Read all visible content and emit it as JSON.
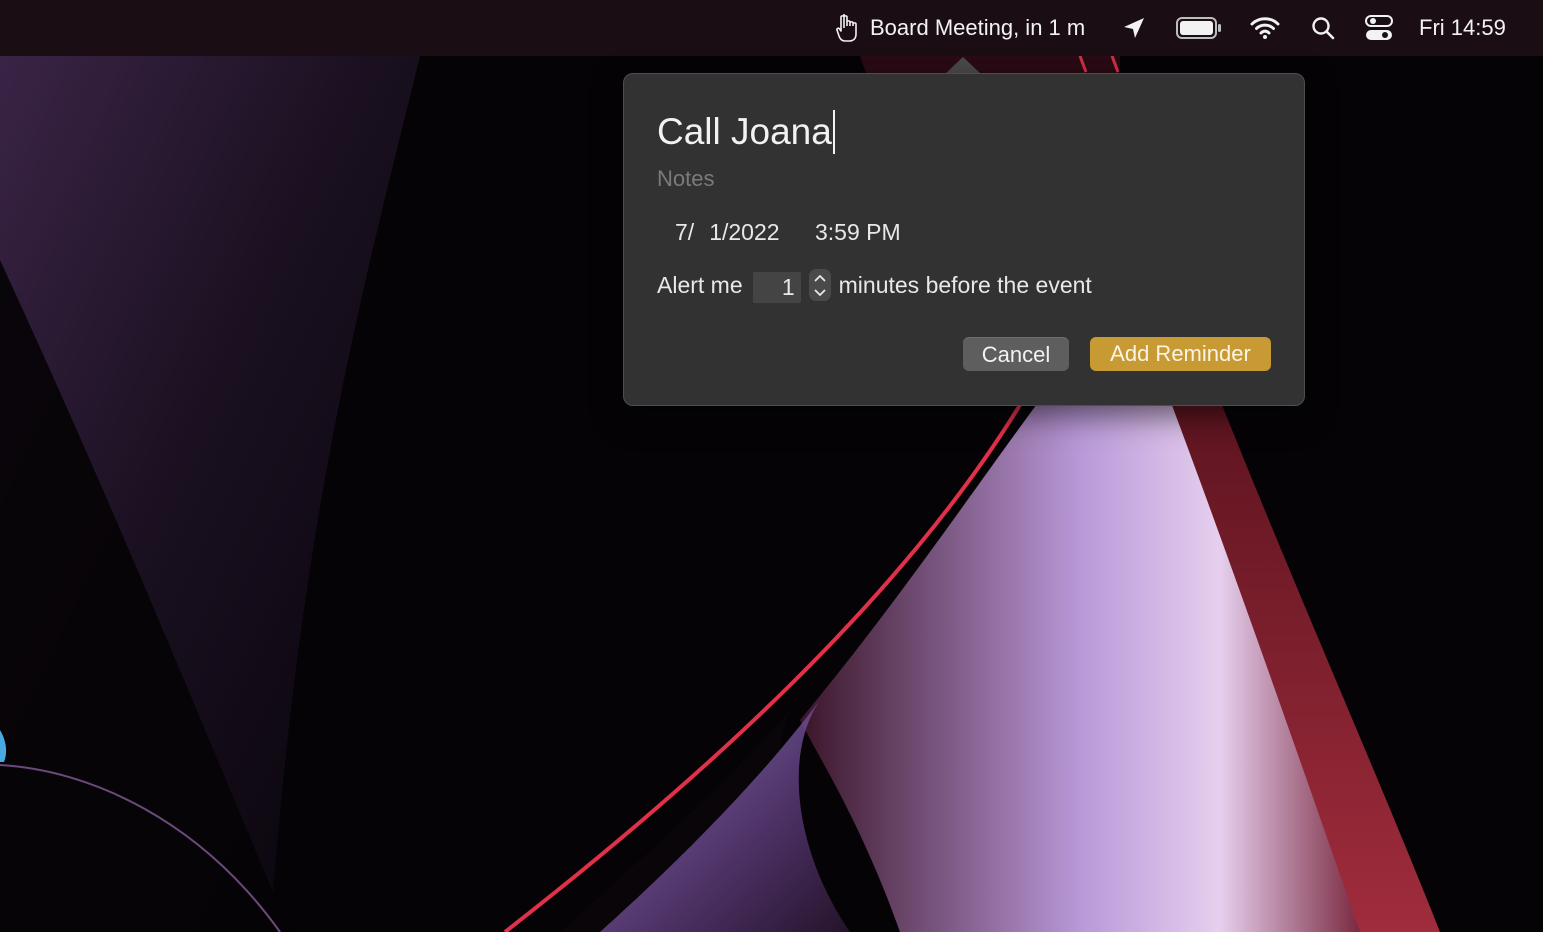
{
  "menubar": {
    "event_label": "Board Meeting, in 1 m",
    "clock": "Fri 14:59",
    "icons": [
      "hand-pointer-icon",
      "location-arrow-icon",
      "battery-icon",
      "wifi-icon",
      "search-icon",
      "control-center-icon"
    ]
  },
  "popover": {
    "title_value": "Call Joana",
    "notes_placeholder": "Notes",
    "date": {
      "month": "7/",
      "day_year": "1/2022"
    },
    "time": "3:59 PM",
    "alert": {
      "prefix": "Alert me",
      "minutes": "1",
      "suffix": "minutes before the event"
    },
    "cancel_label": "Cancel",
    "add_label": "Add Reminder"
  },
  "colors": {
    "accent": "#c89a34",
    "popover_bg": "#323232",
    "menubar_bg": "#1c0e16"
  }
}
